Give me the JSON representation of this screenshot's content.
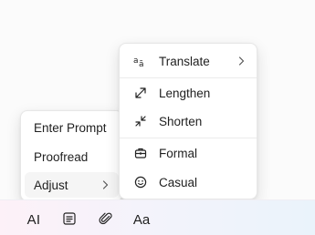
{
  "left_menu": {
    "items": [
      {
        "label": "Enter Prompt"
      },
      {
        "label": "Proofread"
      },
      {
        "label": "Adjust"
      }
    ]
  },
  "adjust_submenu": {
    "items": [
      {
        "label": "Translate",
        "icon": "translate-icon"
      },
      {
        "label": "Lengthen",
        "icon": "expand-arrows-icon"
      },
      {
        "label": "Shorten",
        "icon": "collapse-arrows-icon"
      },
      {
        "label": "Formal",
        "icon": "briefcase-icon"
      },
      {
        "label": "Casual",
        "icon": "smiley-icon"
      }
    ]
  },
  "toolbar": {
    "ai_label": "AI",
    "font_label": "Aa"
  }
}
